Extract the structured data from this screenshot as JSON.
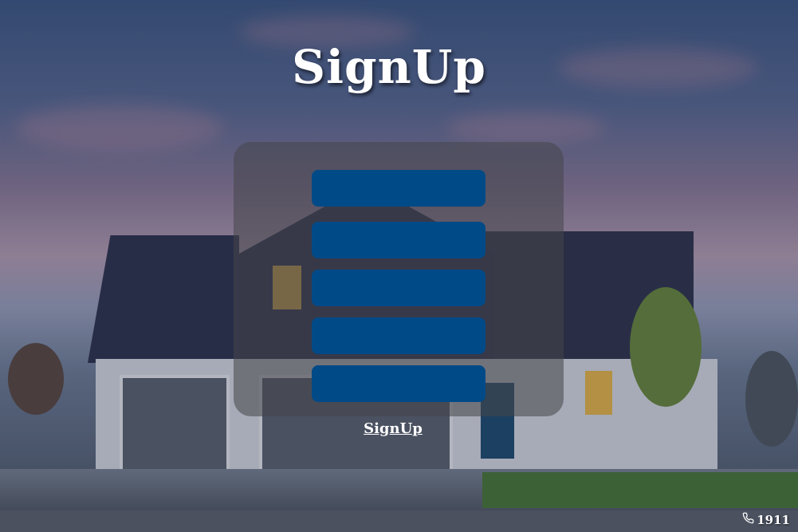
{
  "page": {
    "title": "SignUp"
  },
  "form": {
    "fields": [
      {
        "value": "",
        "placeholder": ""
      },
      {
        "value": "",
        "placeholder": ""
      },
      {
        "value": "",
        "placeholder": ""
      },
      {
        "value": "",
        "placeholder": ""
      },
      {
        "value": "",
        "placeholder": ""
      }
    ],
    "submit_label": "SignUp"
  },
  "footer": {
    "phone_icon": "phone-icon",
    "phone_number": "1911"
  },
  "colors": {
    "field_background": "#004a87",
    "panel_background": "rgba(70,70,75,0.55)",
    "text": "#ffffff"
  }
}
